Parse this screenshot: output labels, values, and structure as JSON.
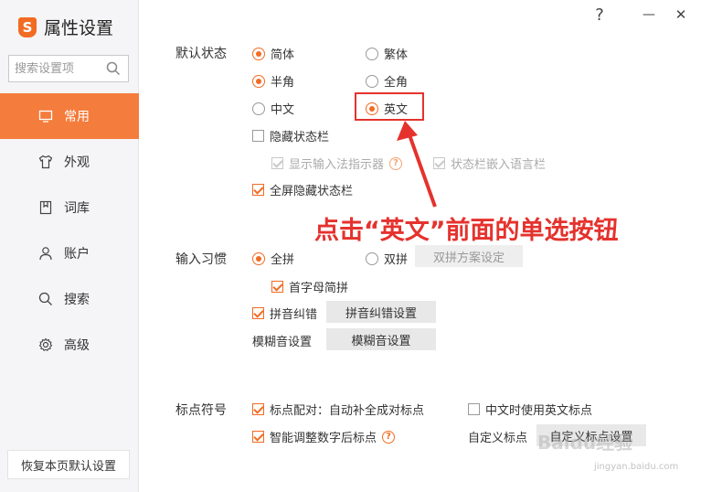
{
  "window": {
    "title": "属性设置",
    "logo_glyph": "S",
    "help_label": "?",
    "minimize_label": "—",
    "close_label": "✕"
  },
  "sidebar": {
    "search_placeholder": "搜索设置项",
    "items": [
      {
        "label": "常用",
        "icon": "monitor-icon",
        "active": true
      },
      {
        "label": "外观",
        "icon": "shirt-icon",
        "active": false
      },
      {
        "label": "词库",
        "icon": "book-icon",
        "active": false
      },
      {
        "label": "账户",
        "icon": "user-icon",
        "active": false
      },
      {
        "label": "搜索",
        "icon": "search-icon",
        "active": false
      },
      {
        "label": "高级",
        "icon": "gear-icon",
        "active": false
      }
    ],
    "restore_label": "恢复本页默认设置"
  },
  "default_state": {
    "label": "默认状态",
    "simplified": "简体",
    "traditional": "繁体",
    "half_width": "半角",
    "full_width": "全角",
    "chinese": "中文",
    "english": "英文",
    "hide_status_bar": "隐藏状态栏",
    "show_ime_indicator": "显示输入法指示器",
    "embed_language_bar": "状态栏嵌入语言栏",
    "fullscreen_hide": "全屏隐藏状态栏"
  },
  "input_habit": {
    "label": "输入习惯",
    "full_pinyin": "全拼",
    "double_pinyin": "双拼",
    "double_pinyin_settings": "双拼方案设定",
    "initial_abbrev": "首字母简拼",
    "pinyin_correction": "拼音纠错",
    "pinyin_correction_settings": "拼音纠错设置",
    "fuzzy_label": "模糊音设置",
    "fuzzy_button": "模糊音设置"
  },
  "punctuation": {
    "label": "标点符号",
    "auto_pair": "标点配对：自动补全成对标点",
    "english_punct_in_chinese": "中文时使用英文标点",
    "smart_adjust": "智能调整数字后标点",
    "custom_label": "自定义标点",
    "custom_button": "自定义标点设置"
  },
  "annotation": {
    "text": "点击“英文”前面的单选按钮"
  },
  "watermark": {
    "main": "Baidu经验",
    "sub": "jingyan.baidu.com"
  },
  "colors": {
    "accent": "#f26b23",
    "sidebar_active": "#f47c3c",
    "annotation_red": "#e5322d"
  }
}
